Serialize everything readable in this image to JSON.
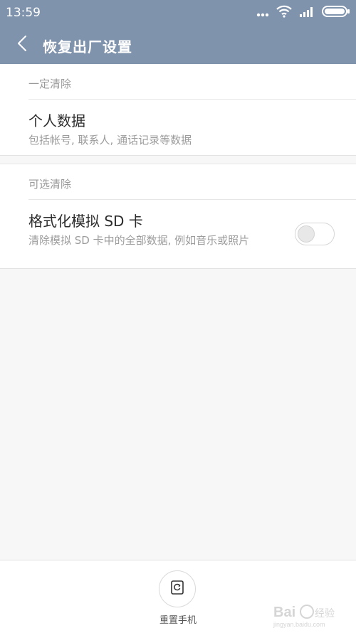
{
  "status_bar": {
    "time": "13:59",
    "icons": [
      "more-dots-icon",
      "wifi-icon",
      "signal-icon",
      "battery-icon"
    ]
  },
  "header": {
    "title": "恢复出厂设置",
    "back_icon": "chevron-left-icon"
  },
  "sections": [
    {
      "label": "一定清除",
      "item": {
        "title": "个人数据",
        "subtitle": "包括帐号, 联系人, 通话记录等数据"
      }
    },
    {
      "label": "可选清除",
      "item": {
        "title": "格式化模拟 SD 卡",
        "subtitle": "清除模拟 SD 卡中的全部数据, 例如音乐或照片",
        "toggle_on": false
      }
    }
  ],
  "bottom": {
    "reset_label": "重置手机",
    "reset_icon": "reset-phone-icon"
  },
  "watermark": {
    "brand": "Bai du 经验",
    "url": "jingyan.baidu.com"
  },
  "colors": {
    "header_bg": "#7f93ad",
    "page_bg": "#f7f7f7",
    "card_bg": "#ffffff"
  }
}
